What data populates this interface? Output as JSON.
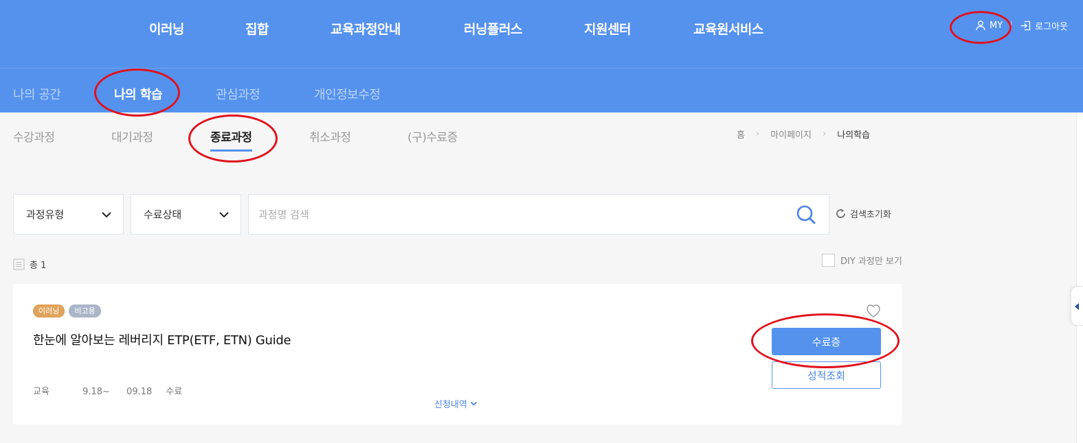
{
  "header": {
    "nav": [
      "이러닝",
      "집합",
      "교육과정안내",
      "러닝플러스",
      "지원센터",
      "교육원서비스"
    ],
    "util": {
      "my_label": "MY",
      "logout_label": "로그아웃"
    }
  },
  "subnav": {
    "items": [
      "나의 공간",
      "나의 학습",
      "관심과정",
      "개인정보수정"
    ],
    "active": "나의 학습"
  },
  "tabs": {
    "items": [
      "수강과정",
      "대기과정",
      "종료과정",
      "취소과정",
      "(구)수료증"
    ],
    "active": "종료과정"
  },
  "breadcrumb": [
    "홈",
    "마이페이지",
    "나의학습"
  ],
  "filters": {
    "course_type": "과정유형",
    "completion_status": "수료상태",
    "search_placeholder": "과정명 검색",
    "reset_label": "검색초기화"
  },
  "list": {
    "total_label": "총 1",
    "diy_label": "DIY 과정만 보기"
  },
  "course": {
    "badges": [
      "이러닝",
      "비고용"
    ],
    "title": "한눈에 알아보는 레버리지 ETP(ETF, ETN) Guide",
    "meta": [
      "교육",
      "9.18~",
      "09.18",
      "수료"
    ],
    "apply_label": "신청내역",
    "certificate_button": "수료증",
    "grade_button": "성적조회"
  },
  "colors": {
    "primary": "#5592ee",
    "annotation_red": "#e0121d",
    "badge_elearning": "#e0a35b",
    "badge_nonemploy": "#aab6c8"
  }
}
